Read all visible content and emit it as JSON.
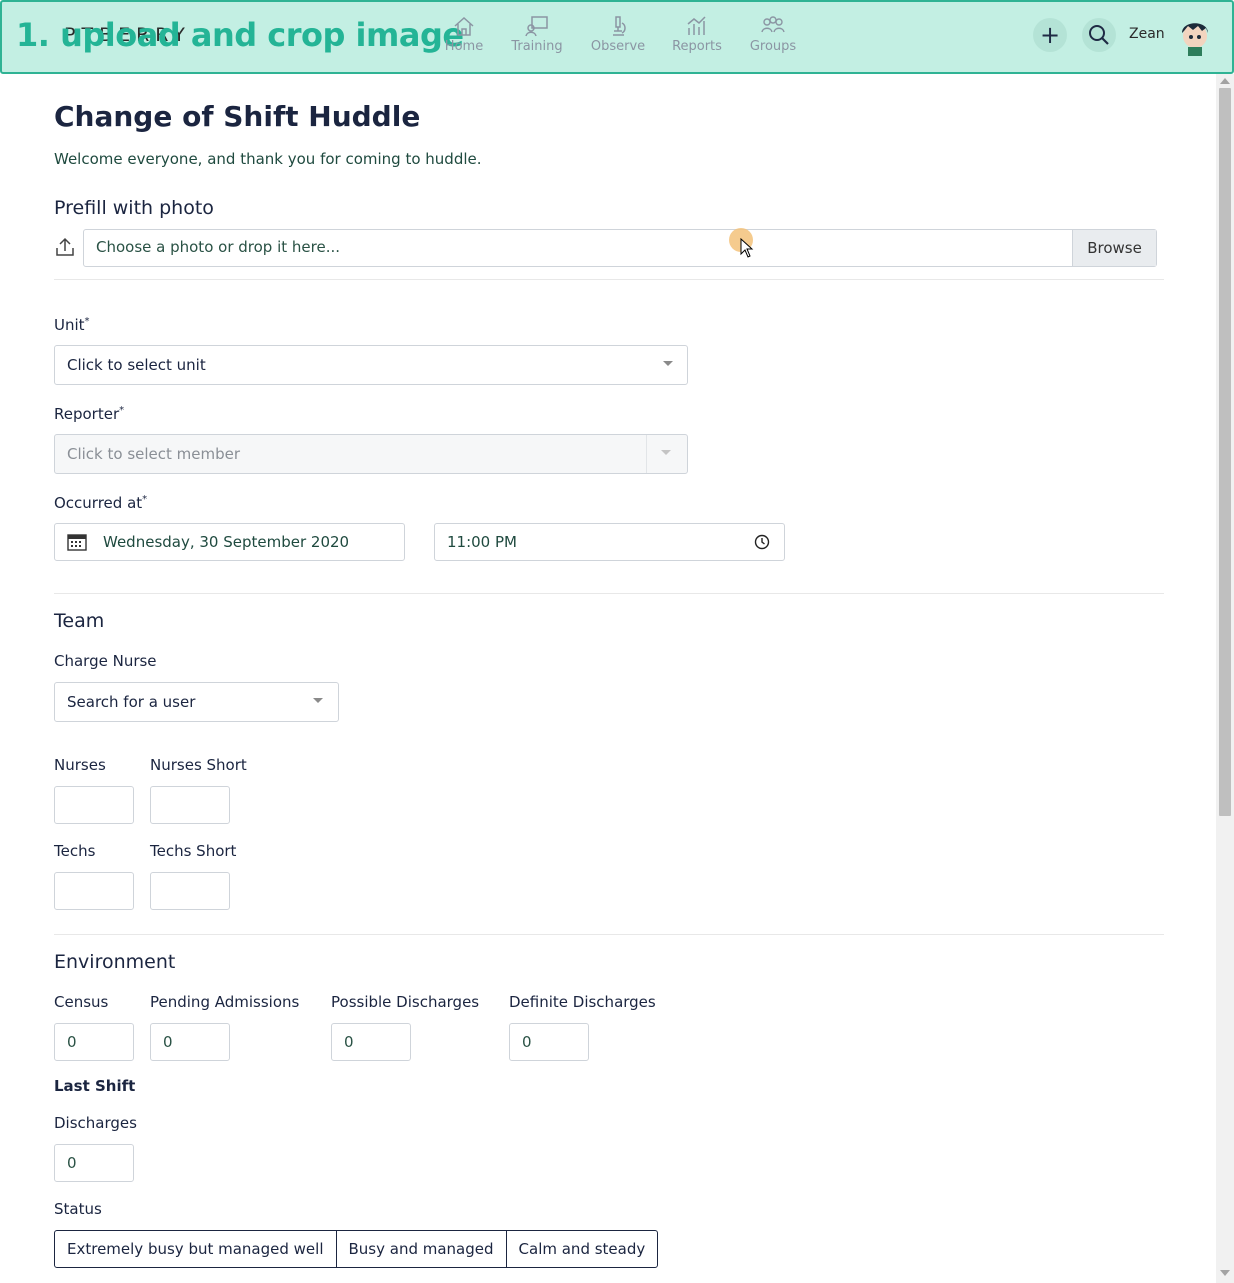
{
  "overlay": {
    "title": "1. upload and crop image"
  },
  "topbar": {
    "brand": "PTBERRY",
    "nav": [
      {
        "label": "Home",
        "icon": "home-icon"
      },
      {
        "label": "Training",
        "icon": "training-icon"
      },
      {
        "label": "Observe",
        "icon": "microscope-icon"
      },
      {
        "label": "Reports",
        "icon": "chart-icon"
      },
      {
        "label": "Groups",
        "icon": "group-icon"
      }
    ],
    "add_icon": "plus-icon",
    "search_icon": "search-icon",
    "user_name": "Zean",
    "accent": "#2fb394",
    "bar_color": "#c3efe3"
  },
  "page": {
    "title": "Change of Shift Huddle",
    "welcome": "Welcome everyone, and thank you for coming to huddle."
  },
  "prefill": {
    "heading": "Prefill with photo",
    "placeholder": "Choose a photo or drop it here...",
    "browse": "Browse"
  },
  "unit": {
    "label": "Unit",
    "required": "*",
    "value": "Click to select unit"
  },
  "reporter": {
    "label": "Reporter",
    "required": "*",
    "value": "Click to select member"
  },
  "occurred": {
    "label": "Occurred at",
    "required": "*",
    "date": "Wednesday, 30 September 2020",
    "time": "11:00 PM"
  },
  "team": {
    "heading": "Team",
    "charge_label": "Charge Nurse",
    "charge_value": "Search for a user",
    "nurses": "Nurses",
    "nurses_short": "Nurses Short",
    "techs": "Techs",
    "techs_short": "Techs Short"
  },
  "environment": {
    "heading": "Environment",
    "census": {
      "label": "Census",
      "value": "0"
    },
    "pending": {
      "label": "Pending Admissions",
      "value": "0"
    },
    "possible": {
      "label": "Possible Discharges",
      "value": "0"
    },
    "definite": {
      "label": "Definite Discharges",
      "value": "0"
    },
    "last_shift": "Last Shift",
    "discharges": {
      "label": "Discharges",
      "value": "0"
    },
    "status_label": "Status",
    "status_options": [
      "Extremely busy but managed well",
      "Busy and managed",
      "Calm and steady"
    ]
  }
}
